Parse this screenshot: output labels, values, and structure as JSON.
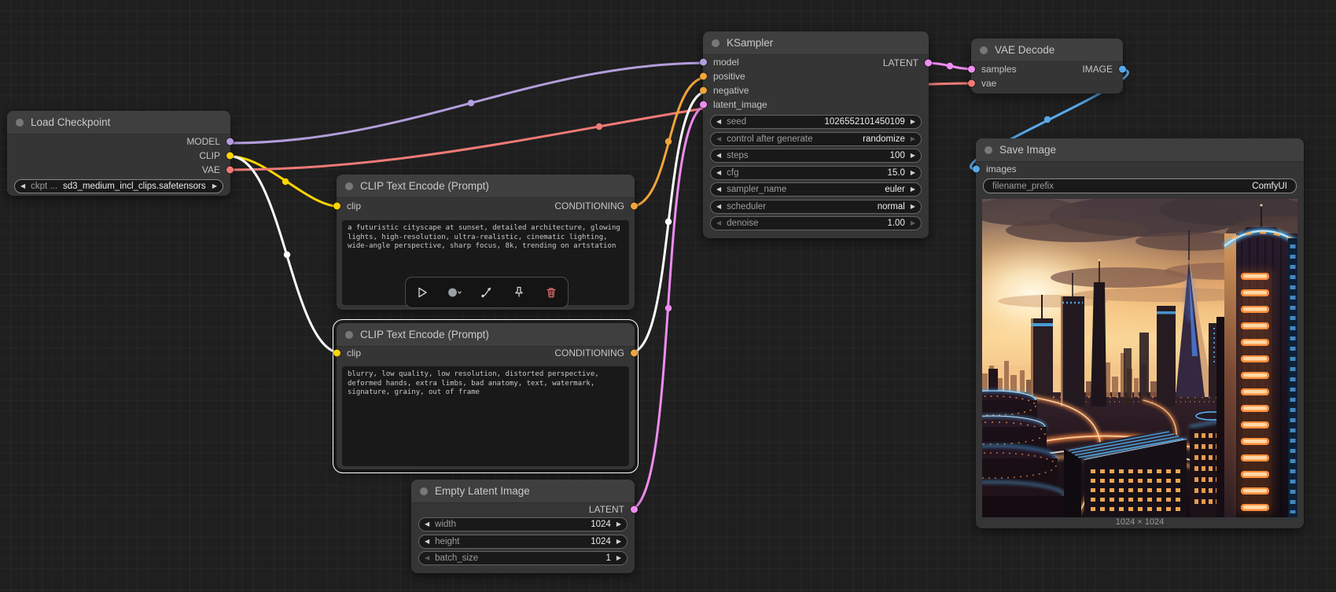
{
  "colors": {
    "model": "#b39ddb",
    "clip": "#ffd500",
    "vae": "#f07a76",
    "conditioning": "#f0a43c",
    "latent": "#f08cf0",
    "image": "#58a8e8",
    "selected": "#ffffff"
  },
  "nodes": {
    "load_checkpoint": {
      "title": "Load Checkpoint",
      "outputs": {
        "model": "MODEL",
        "clip": "CLIP",
        "vae": "VAE"
      },
      "widget": {
        "label": "ckpt ...",
        "value": "sd3_medium_incl_clips.safetensors"
      }
    },
    "clip_positive": {
      "title": "CLIP Text Encode (Prompt)",
      "input_label": "clip",
      "output_label": "CONDITIONING",
      "prompt": "a futuristic cityscape at sunset, detailed architecture, glowing lights, high-resolution, ultra-realistic, cinematic lighting, wide-angle perspective, sharp focus, 8k, trending on artstation"
    },
    "clip_negative": {
      "title": "CLIP Text Encode (Prompt)",
      "input_label": "clip",
      "output_label": "CONDITIONING",
      "prompt": "blurry, low quality, low resolution, distorted perspective, deformed hands, extra limbs, bad anatomy, text, watermark, signature, grainy, out of frame"
    },
    "empty_latent": {
      "title": "Empty Latent Image",
      "output_label": "LATENT",
      "widgets": [
        {
          "label": "width",
          "value": "1024"
        },
        {
          "label": "height",
          "value": "1024"
        },
        {
          "label": "batch_size",
          "value": "1"
        }
      ]
    },
    "ksampler": {
      "title": "KSampler",
      "inputs": [
        "model",
        "positive",
        "negative",
        "latent_image"
      ],
      "output_label": "LATENT",
      "widgets": [
        {
          "label": "seed",
          "value": "1026552101450109"
        },
        {
          "label": "control after generate",
          "value": "randomize"
        },
        {
          "label": "steps",
          "value": "100"
        },
        {
          "label": "cfg",
          "value": "15.0"
        },
        {
          "label": "sampler_name",
          "value": "euler"
        },
        {
          "label": "scheduler",
          "value": "normal"
        },
        {
          "label": "denoise",
          "value": "1.00"
        }
      ]
    },
    "vae_decode": {
      "title": "VAE Decode",
      "inputs": [
        "samples",
        "vae"
      ],
      "output_label": "IMAGE"
    },
    "save_image": {
      "title": "Save Image",
      "input_label": "images",
      "widget": {
        "label": "filename_prefix",
        "value": "ComfyUI"
      },
      "caption": "1024 × 1024"
    }
  }
}
